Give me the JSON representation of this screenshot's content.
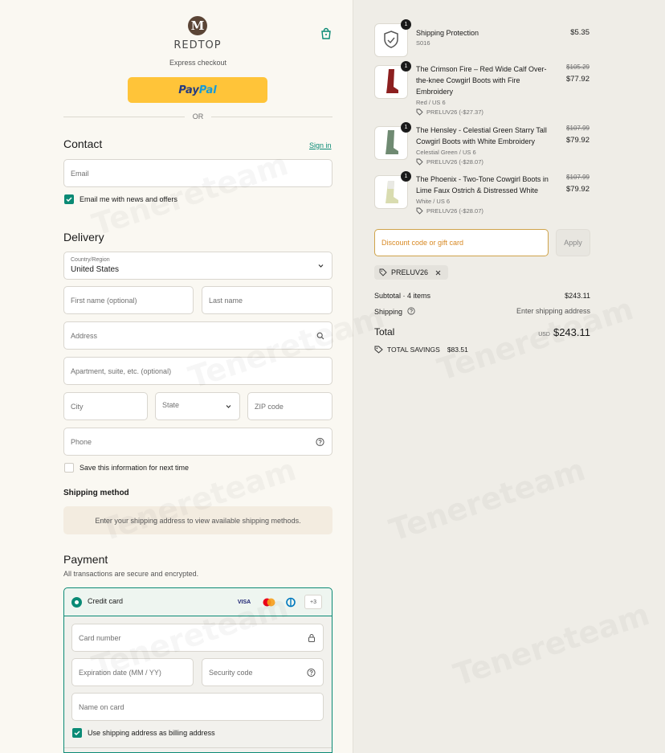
{
  "brand": {
    "name": "REDTOP",
    "mark": "M"
  },
  "express": {
    "label": "Express checkout",
    "paypal_a": "Pay",
    "paypal_b": "Pal"
  },
  "or_label": "OR",
  "contact": {
    "heading": "Contact",
    "sign_in": "Sign in",
    "email_placeholder": "Email",
    "news_label": "Email me with news and offers",
    "news_checked": true
  },
  "delivery": {
    "heading": "Delivery",
    "country_label": "Country/Region",
    "country_value": "United States",
    "first_name": "First name (optional)",
    "last_name": "Last name",
    "address": "Address",
    "apartment": "Apartment, suite, etc. (optional)",
    "city": "City",
    "state": "State",
    "zip": "ZIP code",
    "phone": "Phone",
    "save_info": "Save this information for next time",
    "save_checked": false
  },
  "shipping_method": {
    "heading": "Shipping method",
    "note": "Enter your shipping address to view available shipping methods."
  },
  "payment": {
    "heading": "Payment",
    "subtitle": "All transactions are secure and encrypted.",
    "method_label": "Credit card",
    "card_brands": [
      "VISA",
      "mastercard",
      "diners",
      "+3"
    ],
    "card_number": "Card number",
    "expiry": "Expiration date (MM / YY)",
    "security": "Security code",
    "name_on_card": "Name on card",
    "billing_same": "Use shipping address as billing address",
    "billing_checked": true
  },
  "order": {
    "items": [
      {
        "title": "Shipping Protection",
        "variant": "S016",
        "discount": "",
        "old_price": "",
        "price": "$5.35",
        "qty": "1",
        "thumb": "shield-icon"
      },
      {
        "title": "The Crimson Fire – Red Wide Calf Over-the-knee Cowgirl Boots with Fire Embroidery",
        "variant": "Red / US 6",
        "discount": "PRELUV26 (-$27.37)",
        "old_price": "$105.29",
        "price": "$77.92",
        "qty": "1",
        "thumb": "red-boot",
        "color": "#8c1f1f"
      },
      {
        "title": "The Hensley - Celestial Green Starry Tall Cowgirl Boots with White Embroidery",
        "variant": "Celestial Green / US 6",
        "discount": "PRELUV26 (-$28.07)",
        "old_price": "$107.99",
        "price": "$79.92",
        "qty": "1",
        "thumb": "green-boot",
        "color": "#6f8a72"
      },
      {
        "title": "The Phoenix - Two-Tone Cowgirl Boots in Lime Faux Ostrich & Distressed White",
        "variant": "White / US 6",
        "discount": "PRELUV26 (-$28.07)",
        "old_price": "$107.99",
        "price": "$79.92",
        "qty": "1",
        "thumb": "lime-boot",
        "color": "#d9dcb0"
      }
    ],
    "discount_placeholder": "Discount code or gift card",
    "apply": "Apply",
    "applied_code": "PRELUV26",
    "subtotal_label": "Subtotal · 4 items",
    "subtotal_value": "$243.11",
    "shipping_label": "Shipping",
    "shipping_value": "Enter shipping address",
    "total_label": "Total",
    "currency": "USD",
    "total_value": "$243.11",
    "savings_label": "TOTAL SAVINGS",
    "savings_value": "$83.51"
  },
  "watermark": "Tenereteam",
  "colors": {
    "accent": "#0a8a75",
    "paypal": "#ffc439",
    "left_bg": "#faf8f2",
    "right_bg": "#efede7"
  }
}
